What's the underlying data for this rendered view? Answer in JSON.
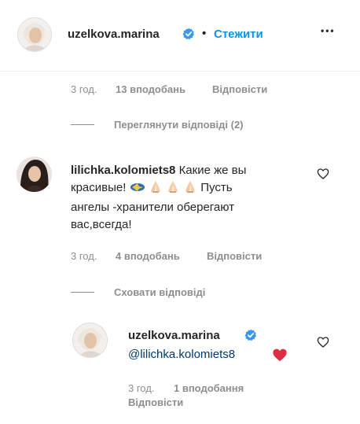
{
  "header": {
    "username": "uzelkova.marina",
    "separator": "•",
    "follow_label": "Стежити",
    "more_label": "•••"
  },
  "comment_prev": {
    "time": "3 год.",
    "likes": "13 вподобань",
    "reply": "Відповісти",
    "view_replies": "Переглянути відповіді (2)"
  },
  "comment_main": {
    "username": "lilichka.kolomiets8",
    "text_line1": "Какие же вы",
    "text_line2_start": "красивые!",
    "text_line2_end": "Пусть",
    "text_line3": "ангелы -хранители оберегают",
    "text_line4": "вас,всегда!",
    "time": "3 год.",
    "likes": "4 вподобань",
    "reply": "Відповісти",
    "hide_replies": "Сховати відповіді"
  },
  "reply": {
    "username": "uzelkova.marina",
    "mention": "@lilichka.kolomiets8",
    "time": "3 год.",
    "likes": "1 вподобання",
    "reply": "Відповісти"
  },
  "colors": {
    "accent": "#0095f6",
    "verified": "#3897f0",
    "heart_red": "#ed4956",
    "mention": "#00376b",
    "meta_gray": "#8e8e8e"
  }
}
